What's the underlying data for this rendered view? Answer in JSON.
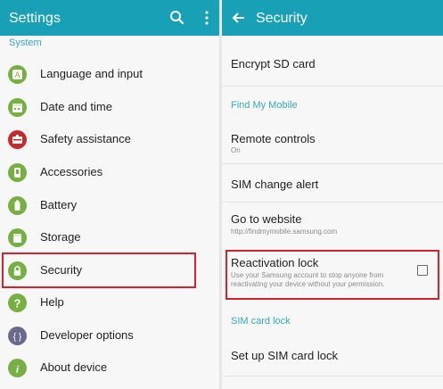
{
  "left": {
    "app_title": "Settings",
    "section": "System",
    "items": [
      {
        "label": "Language and input",
        "color": "#76b043"
      },
      {
        "label": "Date and time",
        "color": "#76b043"
      },
      {
        "label": "Safety assistance",
        "color": "#c62a2a"
      },
      {
        "label": "Accessories",
        "color": "#76b043"
      },
      {
        "label": "Battery",
        "color": "#76b043"
      },
      {
        "label": "Storage",
        "color": "#76b043"
      },
      {
        "label": "Security",
        "color": "#76b043"
      },
      {
        "label": "Help",
        "color": "#76b043"
      },
      {
        "label": "Developer options",
        "color": "#6a6a8e"
      },
      {
        "label": "About device",
        "color": "#76b043"
      }
    ]
  },
  "right": {
    "app_title": "Security",
    "items": {
      "encrypt_sd": "Encrypt SD card",
      "find_my_mobile_header": "Find My Mobile",
      "remote_controls": "Remote controls",
      "remote_controls_sub": "On",
      "sim_change_alert": "SIM change alert",
      "go_to_website": "Go to website",
      "go_to_website_sub": "http://findmymobile.samsung.com",
      "reactivation_lock": "Reactivation lock",
      "reactivation_lock_sub1": "Use your Samsung account to stop anyone from",
      "reactivation_lock_sub2": "reactivating your device without your permission.",
      "sim_card_lock_header": "SIM card lock",
      "set_up_sim_lock": "Set up SIM card lock"
    }
  },
  "colors": {
    "appbar": "#18a1b6",
    "accent_text": "#33a9bf",
    "highlight": "#d8222b"
  }
}
